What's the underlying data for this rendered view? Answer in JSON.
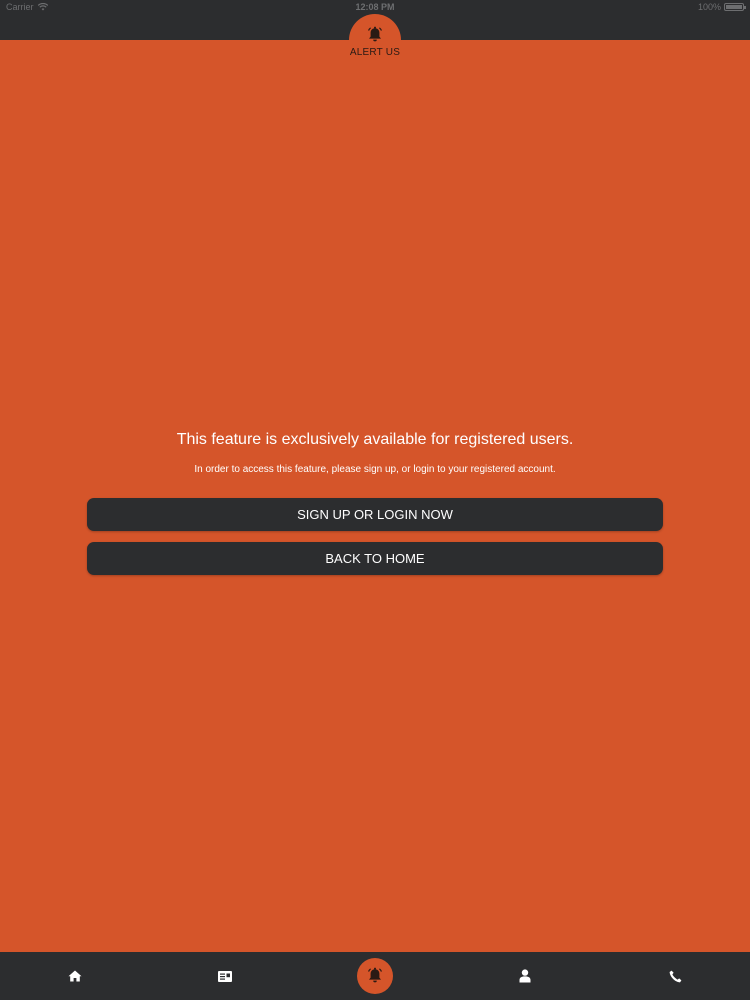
{
  "status_bar": {
    "carrier": "Carrier",
    "time": "12:08 PM",
    "battery": "100%"
  },
  "header": {
    "alert_label": "ALERT US",
    "icon": "bell-icon"
  },
  "main": {
    "title": "This feature is exclusively available for registered users.",
    "subtitle": "In order to access this feature, please sign up, or login to your registered account.",
    "signup_button": "SIGN UP OR LOGIN NOW",
    "home_button": "BACK TO HOME"
  },
  "tab_bar": {
    "items": [
      {
        "name": "home",
        "icon": "home-icon"
      },
      {
        "name": "news",
        "icon": "news-card-icon"
      },
      {
        "name": "alert",
        "icon": "bell-icon"
      },
      {
        "name": "profile",
        "icon": "user-icon"
      },
      {
        "name": "call",
        "icon": "phone-icon"
      }
    ]
  },
  "colors": {
    "accent": "#d5552a",
    "bar": "#2c2d2f",
    "text": "#ffffff"
  }
}
